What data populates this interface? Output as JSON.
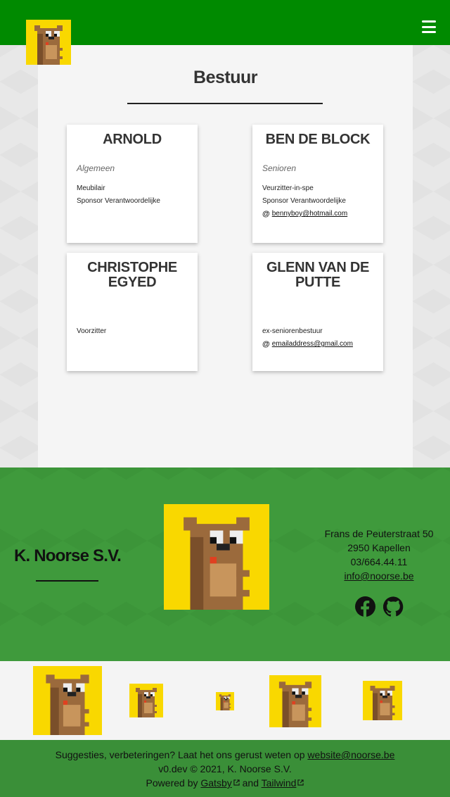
{
  "header": {
    "logo_alt": "K. Noorse S.V. logo",
    "menu_icon": "hamburger-icon"
  },
  "page": {
    "title": "Bestuur"
  },
  "members": [
    {
      "name": "ARNOLD",
      "group": "Algemeen",
      "roles": [
        "Meubilair",
        "Sponsor Verantwoordelijke"
      ],
      "email": ""
    },
    {
      "name": "BEN DE BLOCK",
      "group": "Senioren",
      "roles": [
        "Veurzitter-in-spe",
        "Sponsor Verantwoordelijke"
      ],
      "email": "bennyboy@hotmail.com"
    },
    {
      "name": "CHRISTOPHE EGYED",
      "group": "",
      "roles": [
        "Voorzitter"
      ],
      "email": ""
    },
    {
      "name": "GLENN VAN DE PUTTE",
      "group": "",
      "roles": [
        "ex-seniorenbestuur"
      ],
      "email": "emailaddress@gmail.com"
    }
  ],
  "footer": {
    "club_name": "K. Noorse S.V.",
    "address_line1": "Frans de Peuterstraat 50",
    "address_line2": "2950 Kapellen",
    "phone": "03/664.44.11",
    "email": "info@noorse.be",
    "social_icons": [
      "facebook-icon",
      "github-icon"
    ]
  },
  "bottom": {
    "suggestion_text": "Suggesties, verbeteringen? Laat het ons gerust weten op",
    "suggestion_email": "website@noorse.be",
    "version_line": "v0.dev © 2021, K. Noorse S.V.",
    "powered_by": "Powered by",
    "gatsby": "Gatsby",
    "and": "and",
    "tailwind": "Tailwind"
  },
  "colors": {
    "topbar": "#008a00",
    "footer": "#3f9a3c",
    "logo_bg": "#f9d800"
  }
}
